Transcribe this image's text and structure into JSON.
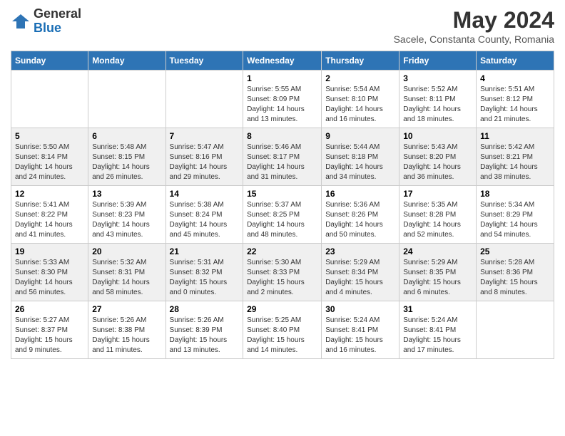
{
  "logo": {
    "general": "General",
    "blue": "Blue"
  },
  "title": "May 2024",
  "subtitle": "Sacele, Constanta County, Romania",
  "days_of_week": [
    "Sunday",
    "Monday",
    "Tuesday",
    "Wednesday",
    "Thursday",
    "Friday",
    "Saturday"
  ],
  "weeks": [
    [
      {
        "day": "",
        "sunrise": "",
        "sunset": "",
        "daylight": ""
      },
      {
        "day": "",
        "sunrise": "",
        "sunset": "",
        "daylight": ""
      },
      {
        "day": "",
        "sunrise": "",
        "sunset": "",
        "daylight": ""
      },
      {
        "day": "1",
        "sunrise": "Sunrise: 5:55 AM",
        "sunset": "Sunset: 8:09 PM",
        "daylight": "Daylight: 14 hours and 13 minutes."
      },
      {
        "day": "2",
        "sunrise": "Sunrise: 5:54 AM",
        "sunset": "Sunset: 8:10 PM",
        "daylight": "Daylight: 14 hours and 16 minutes."
      },
      {
        "day": "3",
        "sunrise": "Sunrise: 5:52 AM",
        "sunset": "Sunset: 8:11 PM",
        "daylight": "Daylight: 14 hours and 18 minutes."
      },
      {
        "day": "4",
        "sunrise": "Sunrise: 5:51 AM",
        "sunset": "Sunset: 8:12 PM",
        "daylight": "Daylight: 14 hours and 21 minutes."
      }
    ],
    [
      {
        "day": "5",
        "sunrise": "Sunrise: 5:50 AM",
        "sunset": "Sunset: 8:14 PM",
        "daylight": "Daylight: 14 hours and 24 minutes."
      },
      {
        "day": "6",
        "sunrise": "Sunrise: 5:48 AM",
        "sunset": "Sunset: 8:15 PM",
        "daylight": "Daylight: 14 hours and 26 minutes."
      },
      {
        "day": "7",
        "sunrise": "Sunrise: 5:47 AM",
        "sunset": "Sunset: 8:16 PM",
        "daylight": "Daylight: 14 hours and 29 minutes."
      },
      {
        "day": "8",
        "sunrise": "Sunrise: 5:46 AM",
        "sunset": "Sunset: 8:17 PM",
        "daylight": "Daylight: 14 hours and 31 minutes."
      },
      {
        "day": "9",
        "sunrise": "Sunrise: 5:44 AM",
        "sunset": "Sunset: 8:18 PM",
        "daylight": "Daylight: 14 hours and 34 minutes."
      },
      {
        "day": "10",
        "sunrise": "Sunrise: 5:43 AM",
        "sunset": "Sunset: 8:20 PM",
        "daylight": "Daylight: 14 hours and 36 minutes."
      },
      {
        "day": "11",
        "sunrise": "Sunrise: 5:42 AM",
        "sunset": "Sunset: 8:21 PM",
        "daylight": "Daylight: 14 hours and 38 minutes."
      }
    ],
    [
      {
        "day": "12",
        "sunrise": "Sunrise: 5:41 AM",
        "sunset": "Sunset: 8:22 PM",
        "daylight": "Daylight: 14 hours and 41 minutes."
      },
      {
        "day": "13",
        "sunrise": "Sunrise: 5:39 AM",
        "sunset": "Sunset: 8:23 PM",
        "daylight": "Daylight: 14 hours and 43 minutes."
      },
      {
        "day": "14",
        "sunrise": "Sunrise: 5:38 AM",
        "sunset": "Sunset: 8:24 PM",
        "daylight": "Daylight: 14 hours and 45 minutes."
      },
      {
        "day": "15",
        "sunrise": "Sunrise: 5:37 AM",
        "sunset": "Sunset: 8:25 PM",
        "daylight": "Daylight: 14 hours and 48 minutes."
      },
      {
        "day": "16",
        "sunrise": "Sunrise: 5:36 AM",
        "sunset": "Sunset: 8:26 PM",
        "daylight": "Daylight: 14 hours and 50 minutes."
      },
      {
        "day": "17",
        "sunrise": "Sunrise: 5:35 AM",
        "sunset": "Sunset: 8:28 PM",
        "daylight": "Daylight: 14 hours and 52 minutes."
      },
      {
        "day": "18",
        "sunrise": "Sunrise: 5:34 AM",
        "sunset": "Sunset: 8:29 PM",
        "daylight": "Daylight: 14 hours and 54 minutes."
      }
    ],
    [
      {
        "day": "19",
        "sunrise": "Sunrise: 5:33 AM",
        "sunset": "Sunset: 8:30 PM",
        "daylight": "Daylight: 14 hours and 56 minutes."
      },
      {
        "day": "20",
        "sunrise": "Sunrise: 5:32 AM",
        "sunset": "Sunset: 8:31 PM",
        "daylight": "Daylight: 14 hours and 58 minutes."
      },
      {
        "day": "21",
        "sunrise": "Sunrise: 5:31 AM",
        "sunset": "Sunset: 8:32 PM",
        "daylight": "Daylight: 15 hours and 0 minutes."
      },
      {
        "day": "22",
        "sunrise": "Sunrise: 5:30 AM",
        "sunset": "Sunset: 8:33 PM",
        "daylight": "Daylight: 15 hours and 2 minutes."
      },
      {
        "day": "23",
        "sunrise": "Sunrise: 5:29 AM",
        "sunset": "Sunset: 8:34 PM",
        "daylight": "Daylight: 15 hours and 4 minutes."
      },
      {
        "day": "24",
        "sunrise": "Sunrise: 5:29 AM",
        "sunset": "Sunset: 8:35 PM",
        "daylight": "Daylight: 15 hours and 6 minutes."
      },
      {
        "day": "25",
        "sunrise": "Sunrise: 5:28 AM",
        "sunset": "Sunset: 8:36 PM",
        "daylight": "Daylight: 15 hours and 8 minutes."
      }
    ],
    [
      {
        "day": "26",
        "sunrise": "Sunrise: 5:27 AM",
        "sunset": "Sunset: 8:37 PM",
        "daylight": "Daylight: 15 hours and 9 minutes."
      },
      {
        "day": "27",
        "sunrise": "Sunrise: 5:26 AM",
        "sunset": "Sunset: 8:38 PM",
        "daylight": "Daylight: 15 hours and 11 minutes."
      },
      {
        "day": "28",
        "sunrise": "Sunrise: 5:26 AM",
        "sunset": "Sunset: 8:39 PM",
        "daylight": "Daylight: 15 hours and 13 minutes."
      },
      {
        "day": "29",
        "sunrise": "Sunrise: 5:25 AM",
        "sunset": "Sunset: 8:40 PM",
        "daylight": "Daylight: 15 hours and 14 minutes."
      },
      {
        "day": "30",
        "sunrise": "Sunrise: 5:24 AM",
        "sunset": "Sunset: 8:41 PM",
        "daylight": "Daylight: 15 hours and 16 minutes."
      },
      {
        "day": "31",
        "sunrise": "Sunrise: 5:24 AM",
        "sunset": "Sunset: 8:41 PM",
        "daylight": "Daylight: 15 hours and 17 minutes."
      },
      {
        "day": "",
        "sunrise": "",
        "sunset": "",
        "daylight": ""
      }
    ]
  ]
}
